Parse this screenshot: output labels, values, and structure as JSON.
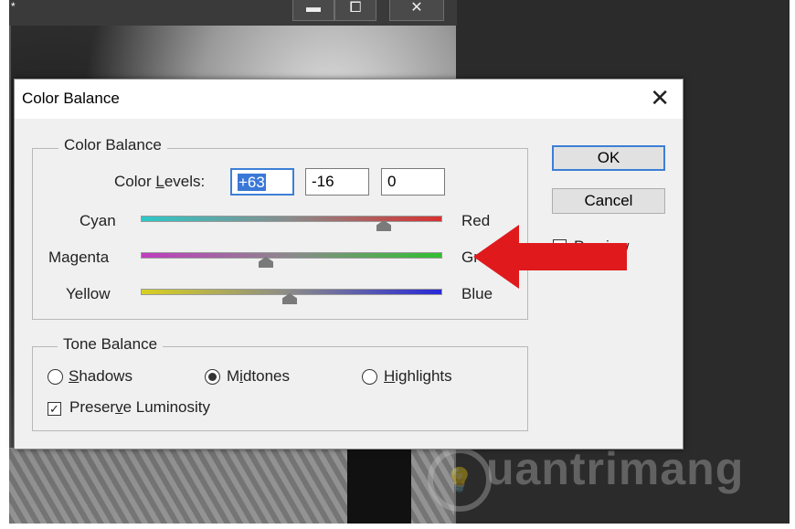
{
  "background_window": {
    "title_marker": "*",
    "buttons": [
      {
        "name": "minimize-icon",
        "glyph": "▬"
      },
      {
        "name": "maximize-icon",
        "glyph": "⧠"
      },
      {
        "name": "close-icon",
        "glyph": "✕"
      }
    ]
  },
  "watermark": {
    "text": "uantrimang",
    "icon": "lightbulb-icon"
  },
  "dialog": {
    "title": "Color Balance",
    "close_glyph": "✕",
    "color_balance_group": {
      "legend": "Color Balance",
      "levels_label_before": "Color ",
      "levels_label_underline": "L",
      "levels_label_after": "evels:",
      "levels": [
        "+63",
        "-16",
        "0"
      ],
      "sliders": [
        {
          "left": "Cyan",
          "right": "Red",
          "value": 63
        },
        {
          "left": "Magenta",
          "right": "Green",
          "value": -16
        },
        {
          "left": "Yellow",
          "right": "Blue",
          "value": 0
        }
      ]
    },
    "tone_balance_group": {
      "legend": "Tone Balance",
      "shadows_u": "S",
      "shadows_rest": "hadows",
      "midtones_pre": "M",
      "midtones_u": "i",
      "midtones_rest": "dtones",
      "highlights_u": "H",
      "highlights_rest": "ighlights",
      "selected": "Midtones",
      "preserve_pre": "Preser",
      "preserve_u": "v",
      "preserve_rest": "e Luminosity",
      "preserve_checked": true
    },
    "buttons": {
      "ok": "OK",
      "cancel": "Cancel"
    },
    "preview": {
      "label": "Preview",
      "checked": true
    }
  },
  "colors": {
    "accent": "#3c7fd6",
    "arrow": "#e0191d"
  }
}
